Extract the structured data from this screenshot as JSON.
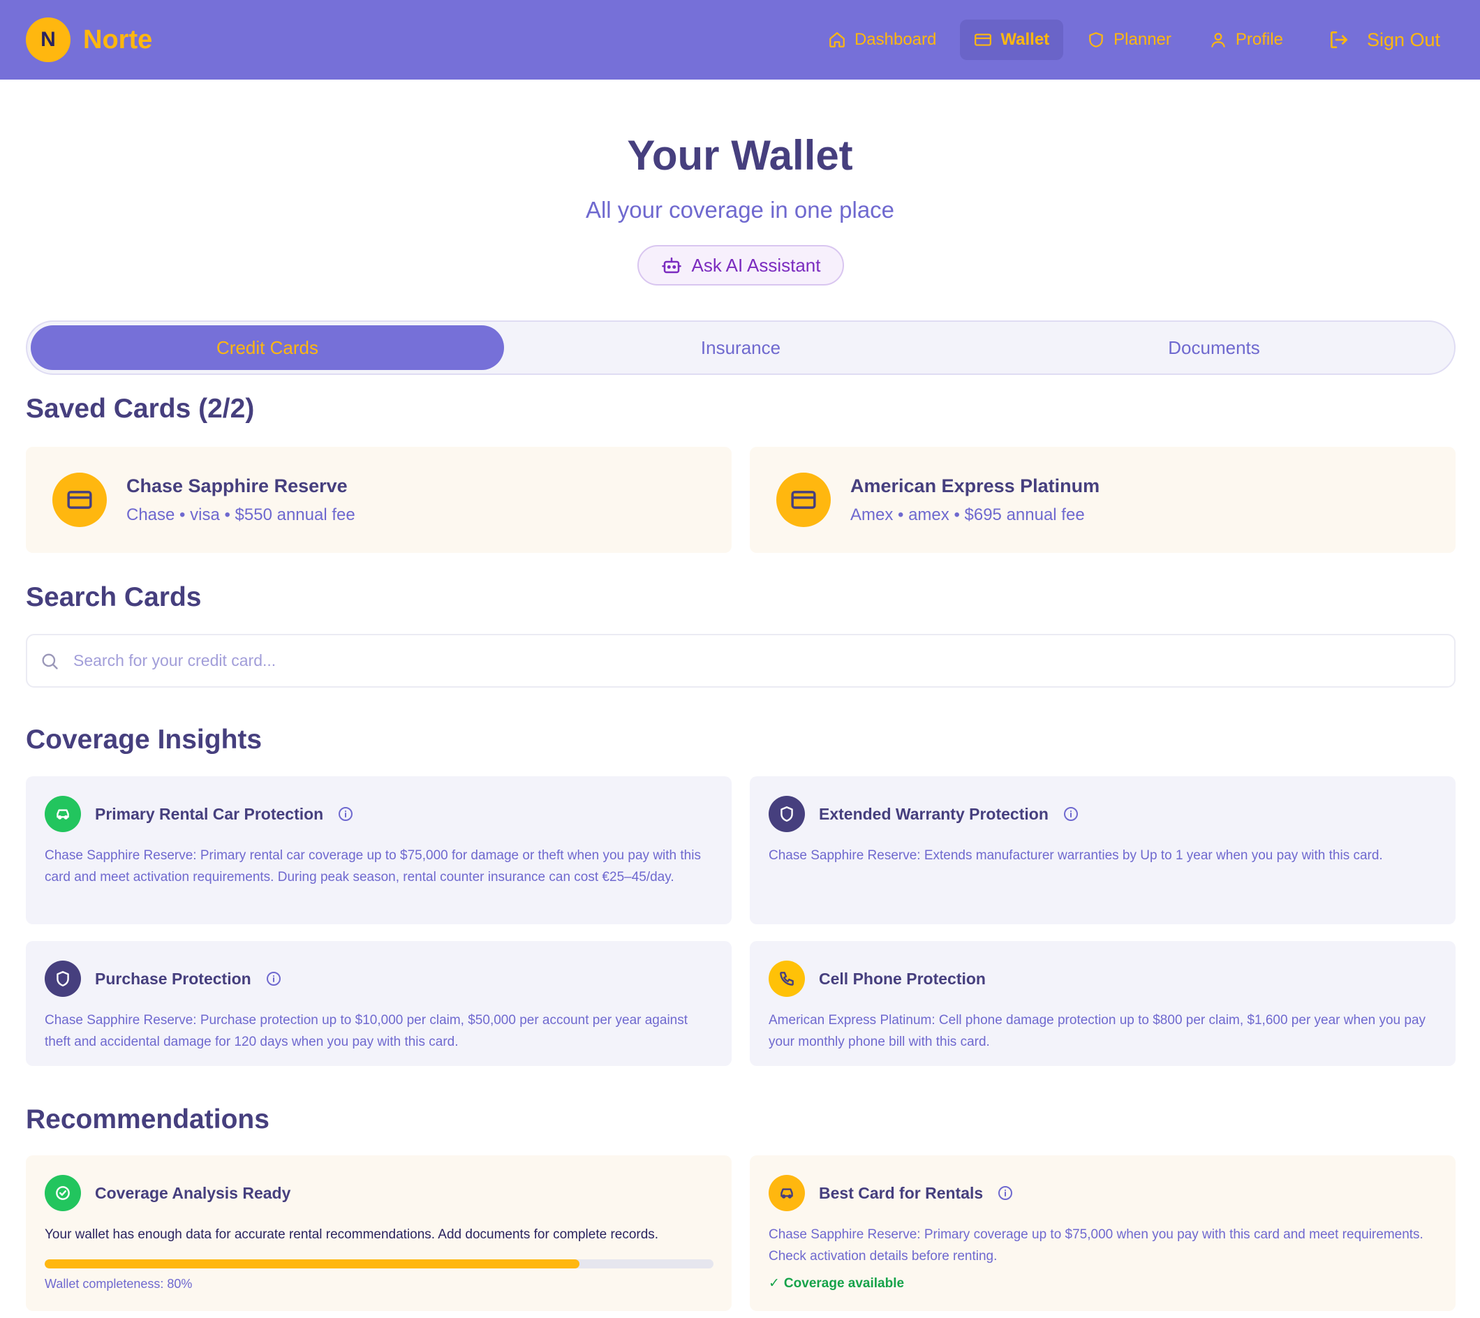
{
  "header": {
    "logo_letter": "N",
    "brand": "Norte",
    "nav": [
      {
        "label": "Dashboard",
        "icon": "home-icon"
      },
      {
        "label": "Wallet",
        "icon": "wallet-icon",
        "active": true
      },
      {
        "label": "Planner",
        "icon": "shield-icon"
      },
      {
        "label": "Profile",
        "icon": "user-icon"
      }
    ],
    "signout": "Sign Out"
  },
  "hero": {
    "title": "Your Wallet",
    "subtitle": "All your coverage in one place",
    "ai_button": "Ask AI Assistant"
  },
  "tabs": [
    {
      "label": "Credit Cards",
      "active": true
    },
    {
      "label": "Insurance"
    },
    {
      "label": "Documents"
    }
  ],
  "saved": {
    "title": "Saved Cards (2/2)",
    "cards": [
      {
        "name": "Chase Sapphire Reserve",
        "meta": "Chase • visa • $550 annual fee"
      },
      {
        "name": "American Express Platinum",
        "meta": "Amex • amex • $695 annual fee"
      }
    ]
  },
  "search": {
    "title": "Search Cards",
    "placeholder": "Search for your credit card..."
  },
  "insights": {
    "title": "Coverage Insights",
    "items": [
      {
        "title": "Primary Rental Car Protection",
        "icon": "car-icon",
        "color": "#22c55e",
        "text": "Chase Sapphire Reserve: Primary rental car coverage up to $75,000 for damage or theft when you pay with this card and meet activation requirements. During peak season, rental counter insurance can cost €25–45/day."
      },
      {
        "title": "Extended Warranty Protection",
        "icon": "shield-icon",
        "color": "#463f7e",
        "text": "Chase Sapphire Reserve: Extends manufacturer warranties by Up to 1 year when you pay with this card."
      },
      {
        "title": "Purchase Protection",
        "icon": "shield-icon",
        "color": "#463f7e",
        "text": "Chase Sapphire Reserve: Purchase protection up to $10,000 per claim, $50,000 per account per year against theft and accidental damage for 120 days when you pay with this card."
      },
      {
        "title": "Cell Phone Protection",
        "icon": "phone-icon",
        "color": "#ffc107",
        "text": "American Express Platinum: Cell phone damage protection up to $800 per claim, $1,600 per year when you pay your monthly phone bill with this card."
      }
    ]
  },
  "recommendations": {
    "title": "Recommendations",
    "analysis": {
      "title": "Coverage Analysis Ready",
      "text": "Your wallet has enough data for accurate rental recommendations. Add documents for complete records.",
      "progress": 0.8,
      "progress_label": "Wallet completeness: 80%"
    },
    "best": {
      "title": "Best Card for Rentals",
      "text": "Chase Sapphire Reserve: Primary coverage up to $75,000 when you pay with this card and meet requirements. Check activation details before renting.",
      "status": "Coverage available"
    }
  },
  "colors": {
    "primary": "#7670d8",
    "accent": "#ffb70f",
    "text_dark": "#463f7e",
    "success": "#22c55e"
  }
}
